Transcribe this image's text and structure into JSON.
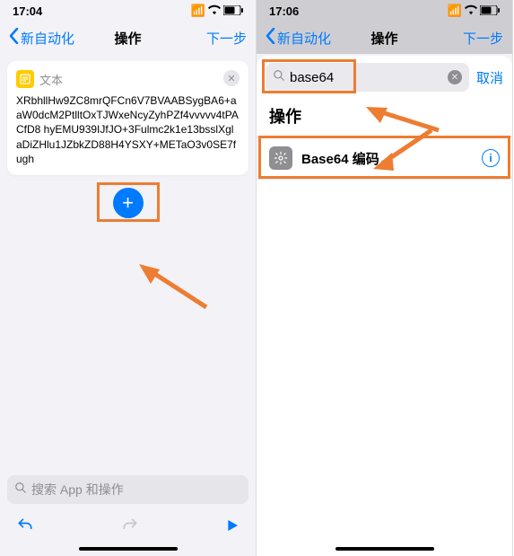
{
  "left": {
    "status": {
      "time": "17:04"
    },
    "nav": {
      "back": "新自动化",
      "title": "操作",
      "next": "下一步"
    },
    "textCard": {
      "label": "文本",
      "content": "XRbhllHw9ZC8mrQFCn6V7BVAABSygBA6+aaW0dcM2PtlltOxTJWxeNcyZyhPZf4vvvvv4tPACfD8\nhyEMU939IJfJO+3Fulmc2k1e13bsslXglaDiZHlu1JZbkZD88H4YSXY+METaO3v0SE7fugh"
    },
    "search": {
      "placeholder": "搜索 App 和操作"
    }
  },
  "right": {
    "status": {
      "time": "17:06"
    },
    "nav": {
      "back": "新自动化",
      "title": "操作",
      "next": "下一步"
    },
    "sheet": {
      "searchValue": "base64",
      "cancel": "取消",
      "sectionTitle": "操作",
      "result": {
        "label": "Base64 编码"
      }
    }
  },
  "colors": {
    "accent": "#007aff",
    "highlight": "#ed7d31"
  }
}
